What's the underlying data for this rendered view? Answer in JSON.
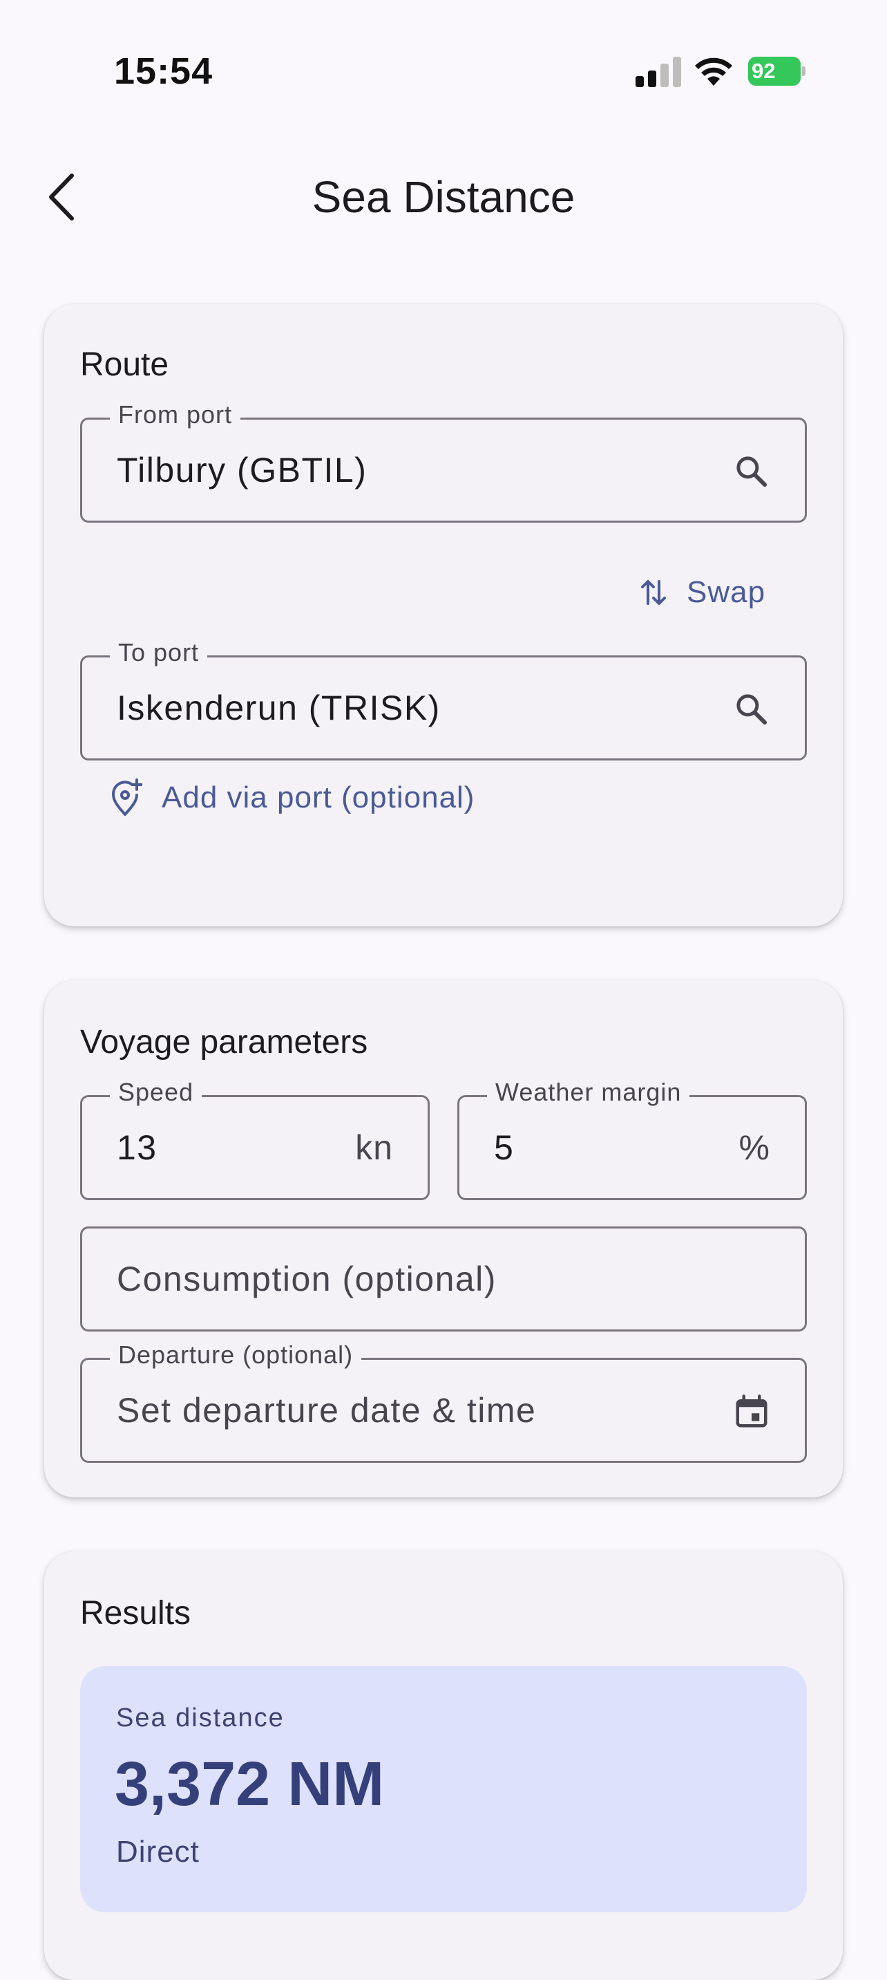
{
  "status_bar": {
    "time": "15:54",
    "battery_level": "92"
  },
  "app_bar": {
    "title": "Sea Distance",
    "back_icon": "chevron-left-icon"
  },
  "route": {
    "title": "Route",
    "from_port": {
      "label": "From port",
      "value": "Tilbury (GBTIL)",
      "icon": "search-icon"
    },
    "swap_label": "Swap",
    "to_port": {
      "label": "To port",
      "value": "Iskenderun (TRISK)",
      "icon": "search-icon"
    },
    "add_via_label": "Add via port (optional)"
  },
  "voyage": {
    "title": "Voyage parameters",
    "speed": {
      "label": "Speed",
      "value": "13",
      "suffix": "kn"
    },
    "weather_margin": {
      "label": "Weather margin",
      "value": "5",
      "suffix": "%"
    },
    "consumption": {
      "placeholder": "Consumption (optional)"
    },
    "departure": {
      "label": "Departure (optional)",
      "placeholder": "Set departure date & time",
      "icon": "calendar-icon"
    }
  },
  "results": {
    "title": "Results",
    "sea_distance_label": "Sea distance",
    "sea_distance_value": "3,372 NM",
    "route_type": "Direct"
  },
  "colors": {
    "accent": "#4A5A96",
    "result_bg": "#DDE1FC",
    "card_bg": "#F4F2F7",
    "battery": "#34C759"
  }
}
